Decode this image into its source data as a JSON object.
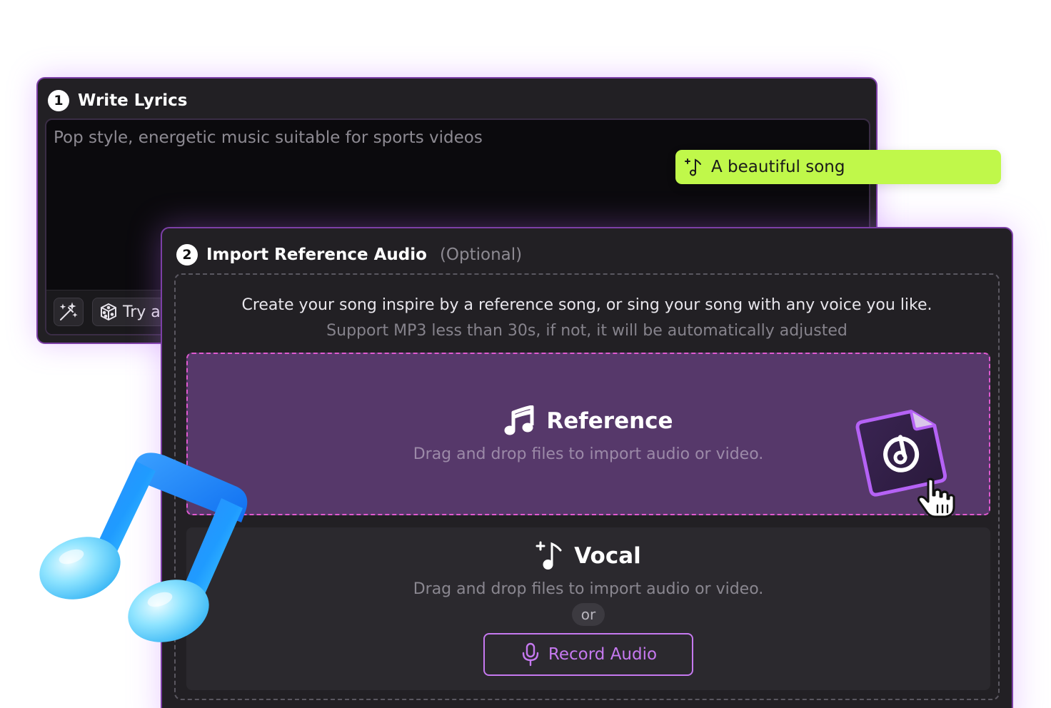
{
  "lyrics_panel": {
    "step": "1",
    "title": "Write Lyrics",
    "placeholder": "Pop style, energetic music suitable for sports videos",
    "try_label": "Try a"
  },
  "suggestion_chip": {
    "text": "A beautiful song",
    "color": "#c0f84a"
  },
  "import_panel": {
    "step": "2",
    "title": "Import Reference Audio",
    "optional_label": "(Optional)",
    "description": "Create your song inspire by a reference song, or sing your song with any voice you like.",
    "sub_description": "Support MP3 less than 30s, if not, it will be automatically adjusted",
    "reference": {
      "title": "Reference",
      "hint": "Drag and drop files to import audio or video."
    },
    "vocal": {
      "title": "Vocal",
      "hint": "Drag and drop files to import audio or video.",
      "or_label": "or",
      "record_label": "Record Audio"
    }
  },
  "colors": {
    "accent_purple": "#c679f0",
    "panel_border": "#7c3fa6",
    "reference_zone": "#56386a",
    "reference_dash": "#e05ad0"
  },
  "icons": [
    "magic-wand-icon",
    "dice-icon",
    "music-spark-icon",
    "music-note-icon",
    "vocal-icon",
    "microphone-icon",
    "audio-file-icon",
    "pointer-hand-icon"
  ]
}
